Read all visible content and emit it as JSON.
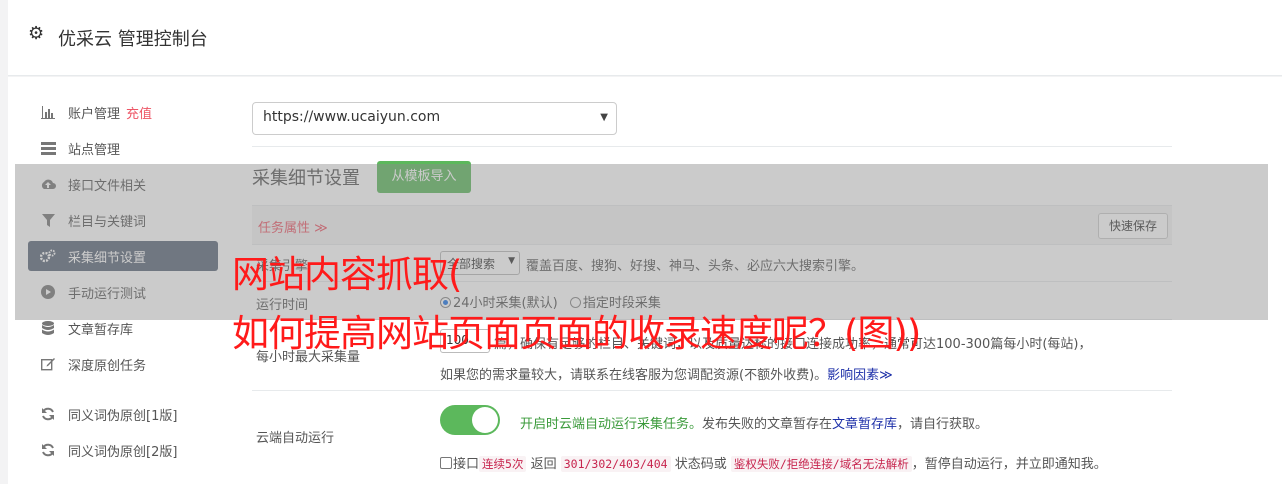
{
  "header": {
    "icon": "gear-icon",
    "title": "优采云 管理控制台"
  },
  "sidebar": {
    "items": [
      {
        "icon": "bar-chart-icon",
        "label": "账户管理",
        "extra": "充值"
      },
      {
        "icon": "server-icon",
        "label": "站点管理"
      },
      {
        "icon": "cloud-upload-icon",
        "label": "接口文件相关"
      },
      {
        "icon": "filter-icon",
        "label": "栏目与关键词"
      },
      {
        "icon": "gears-icon",
        "label": "采集细节设置"
      },
      {
        "icon": "play-circle-icon",
        "label": "手动运行测试"
      },
      {
        "icon": "database-icon",
        "label": "文章暂存库"
      },
      {
        "icon": "edit-icon",
        "label": "深度原创任务"
      },
      {
        "icon": "refresh-icon",
        "label": "同义词伪原创[1版]"
      },
      {
        "icon": "refresh-icon",
        "label": "同义词伪原创[2版]"
      }
    ],
    "active_index": 4
  },
  "site_select": {
    "value": "https://www.ucaiyun.com"
  },
  "section": {
    "title": "采集细节设置",
    "import_button": "从模板导入"
  },
  "task_bar": {
    "label": "任务属性 ≫",
    "quick_save": "快速保存"
  },
  "engine_row": {
    "label": "采集引擎",
    "select_value": "全部搜索",
    "note": "覆盖百度、搜狗、好搜、神马、头条、必应六大搜索引擎。"
  },
  "runtime_row": {
    "label": "运行时间",
    "option1": "24小时采集(默认)",
    "option2": "指定时段采集"
  },
  "quantity_row": {
    "label": "每小时最大采集量",
    "value": "100",
    "line1": "篇，确保有足够的栏目、关键词，以及质量达标的接口连接成功率，通常可达100-300篇每小时(每站)，",
    "line2": "如果您的需求量较大，请联系在线客服为您调配资源(不额外收费)。",
    "link": "影响因素≫"
  },
  "cloud_row": {
    "label": "云端自动运行",
    "enabled": true,
    "note_green": "开启时云端自动运行采集任务。",
    "note_text": "发布失败的文章暂存在",
    "note_link": "文章暂存库",
    "note_tail": "，请自行获取。",
    "l2_a": "接口",
    "l2_code1": "连续5次",
    "l2_b": " 返回 ",
    "l2_code2": "301/302/403/404",
    "l2_c": " 状态码或 ",
    "l2_code3": "鉴权失败/拒绝连接/域名无法解析",
    "l2_d": "，暂停自动运行，并立即通知我。"
  },
  "watermark": {
    "line1": "网站内容抓取(",
    "line2": "如何提高网站页面页面的收录速度呢？(图))"
  },
  "colors": {
    "active_nav": "#5a6678",
    "green": "#5cb85c",
    "red": "#ed5565",
    "link": "#1c2fa8",
    "watermark": "#ff1a1a"
  }
}
